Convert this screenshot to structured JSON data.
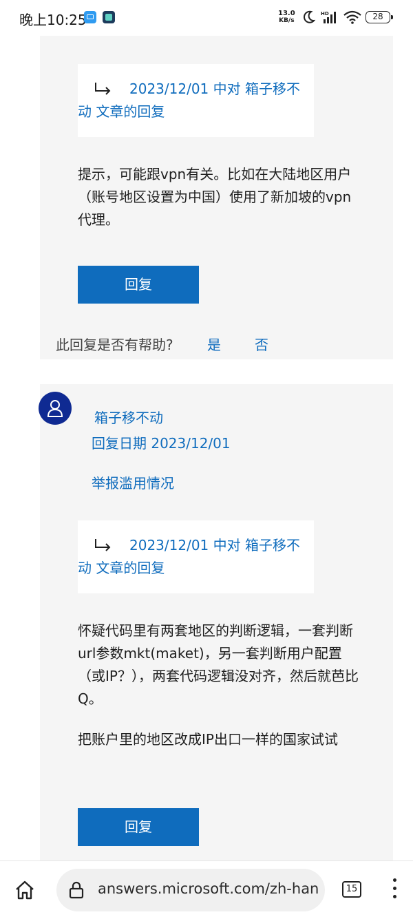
{
  "status_bar": {
    "time": "晚上10:25",
    "net_speed_value": "13.0",
    "net_speed_unit": "KB/s",
    "signal_label": "HD",
    "battery": "28"
  },
  "card1": {
    "quote": "2023/12/01 中对 箱子移不动 文章的回复",
    "body": "提示，可能跟vpn有关。比如在大陆地区用户（账号地区设置为中国）使用了新加坡的vpn代理。",
    "reply_label": "回复",
    "helpful_question": "此回复是否有帮助?",
    "helpful_yes": "是",
    "helpful_no": "否"
  },
  "card2": {
    "author": "箱子移不动",
    "reply_date": "回复日期 2023/12/01",
    "report": "举报滥用情况",
    "quote": "2023/12/01 中对 箱子移不动 文章的回复",
    "body_p1": "怀疑代码里有两套地区的判断逻辑，一套判断url参数mkt(maket)，另一套判断用户配置（或IP？），两套代码逻辑没对齐，然后就芭比Q。",
    "body_p2": "把账户里的地区改成IP出口一样的国家试试",
    "reply_label": "回复"
  },
  "browser": {
    "url": "answers.microsoft.com/zh-hans",
    "tab_count": "15"
  },
  "colors": {
    "accent": "#0f6cbd",
    "avatar": "#0f2a92",
    "card_bg": "#f5f5f5"
  }
}
